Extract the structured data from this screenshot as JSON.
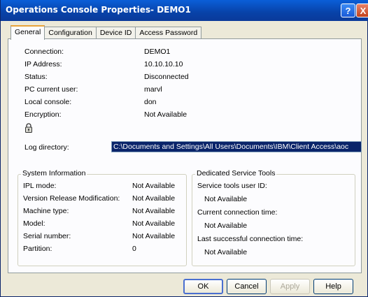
{
  "window": {
    "title": "Operations Console Properties- DEMO1",
    "help_button": "?",
    "close_button": "X"
  },
  "tabs": [
    {
      "label": "General"
    },
    {
      "label": "Configuration"
    },
    {
      "label": "Device ID"
    },
    {
      "label": "Access Password"
    }
  ],
  "general": {
    "fields": [
      {
        "label": "Connection:",
        "value": "DEMO1"
      },
      {
        "label": "IP Address:",
        "value": "10.10.10.10"
      },
      {
        "label": "Status:",
        "value": "Disconnected"
      },
      {
        "label": "PC current user:",
        "value": "marvl"
      },
      {
        "label": "Local console:",
        "value": "don"
      },
      {
        "label": "Encryption:",
        "value": "Not Available"
      }
    ],
    "lock_icon": "lock-icon",
    "log_directory_label": "Log directory:",
    "log_directory_value": "C:\\Documents and Settings\\All Users\\Documents\\IBM\\Client Access\\aoc"
  },
  "system_information": {
    "title": "System Information",
    "rows": [
      {
        "label": "IPL mode:",
        "value": "Not Available"
      },
      {
        "label": "Version Release Modification:",
        "value": "Not Available"
      },
      {
        "label": "Machine type:",
        "value": "Not Available"
      },
      {
        "label": "Model:",
        "value": "Not Available"
      },
      {
        "label": "Serial number:",
        "value": "Not Available"
      },
      {
        "label": "Partition:",
        "value": "0"
      }
    ]
  },
  "dedicated_service_tools": {
    "title": "Dedicated Service Tools",
    "items": [
      {
        "label": "Service tools user ID:",
        "value": "Not Available"
      },
      {
        "label": "Current connection time:",
        "value": "Not Available"
      },
      {
        "label": "Last successful connection time:",
        "value": "Not Available"
      }
    ]
  },
  "buttons": {
    "ok": "OK",
    "cancel": "Cancel",
    "apply": "Apply",
    "help": "Help"
  }
}
